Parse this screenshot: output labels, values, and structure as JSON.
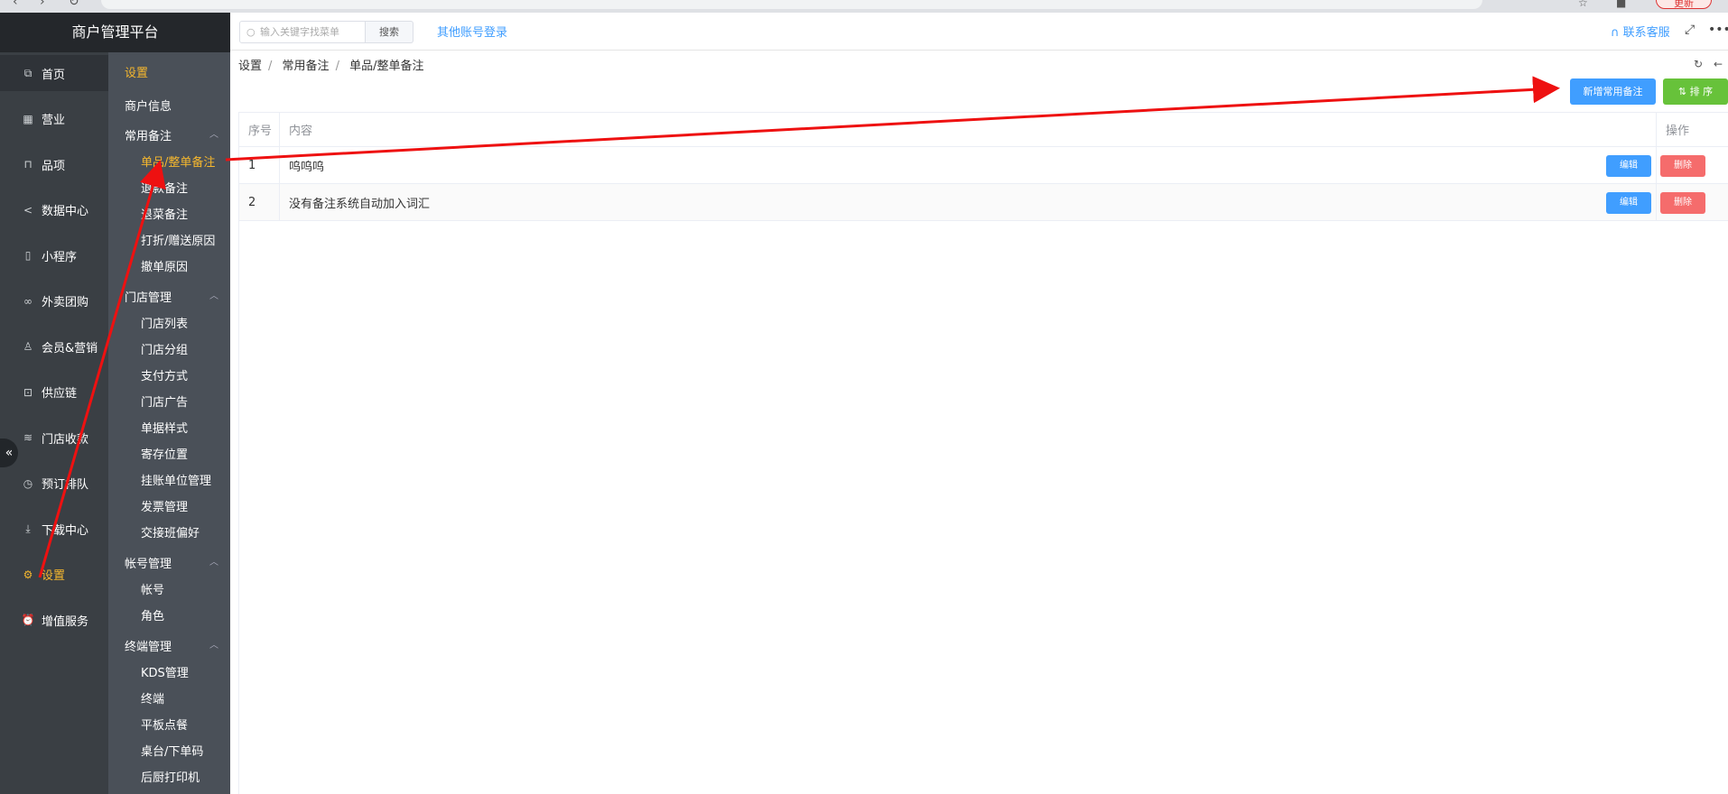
{
  "browser": {
    "update_label": "更新"
  },
  "brand": {
    "title": "商户管理平台"
  },
  "nav": [
    {
      "label": "首页",
      "icon": "external-link-icon"
    },
    {
      "label": "营业",
      "icon": "calendar-icon"
    },
    {
      "label": "品项",
      "icon": "shopping-bag-icon"
    },
    {
      "label": "数据中心",
      "icon": "share-icon"
    },
    {
      "label": "小程序",
      "icon": "mobile-icon"
    },
    {
      "label": "外卖团购",
      "icon": "bicycle-icon"
    },
    {
      "label": "会员&营销",
      "icon": "user-icon"
    },
    {
      "label": "供应链",
      "icon": "truck-icon"
    },
    {
      "label": "门店收款",
      "icon": "coins-icon"
    },
    {
      "label": "预订排队",
      "icon": "clock-icon"
    },
    {
      "label": "下载中心",
      "icon": "download-icon"
    },
    {
      "label": "设置",
      "icon": "gear-icon"
    },
    {
      "label": "增值服务",
      "icon": "alarm-icon"
    }
  ],
  "submenu": {
    "title": "设置",
    "item_merchant": "商户信息",
    "groups": [
      {
        "label": "常用备注",
        "items": [
          "单品/整单备注",
          "退款备注",
          "退菜备注",
          "打折/赠送原因",
          "撤单原因"
        ]
      },
      {
        "label": "门店管理",
        "items": [
          "门店列表",
          "门店分组",
          "支付方式",
          "门店广告",
          "单据样式",
          "寄存位置",
          "挂账单位管理",
          "发票管理",
          "交接班偏好"
        ]
      },
      {
        "label": "帐号管理",
        "items": [
          "帐号",
          "角色"
        ]
      },
      {
        "label": "终端管理",
        "items": [
          "KDS管理",
          "终端",
          "平板点餐",
          "桌台/下单码",
          "后厨打印机"
        ]
      }
    ]
  },
  "topbar": {
    "search_placeholder": "输入关键字找菜单",
    "search_button": "搜索",
    "other_login": "其他账号登录",
    "service": "联系客服"
  },
  "breadcrumb": [
    "设置",
    "常用备注",
    "单品/整单备注"
  ],
  "actions": {
    "add": "新增常用备注",
    "sort": "排 序"
  },
  "table": {
    "headers": [
      "序号",
      "内容",
      "操作"
    ],
    "rows": [
      {
        "index": "1",
        "content": "呜呜呜"
      },
      {
        "index": "2",
        "content": "没有备注系统自动加入词汇"
      }
    ],
    "edit_label": "编辑",
    "delete_label": "删除"
  },
  "colors": {
    "accent": "#f5b72e",
    "primary": "#409eff",
    "success": "#67c23a",
    "danger": "#f56c6c",
    "annotation": "#ee1111"
  }
}
